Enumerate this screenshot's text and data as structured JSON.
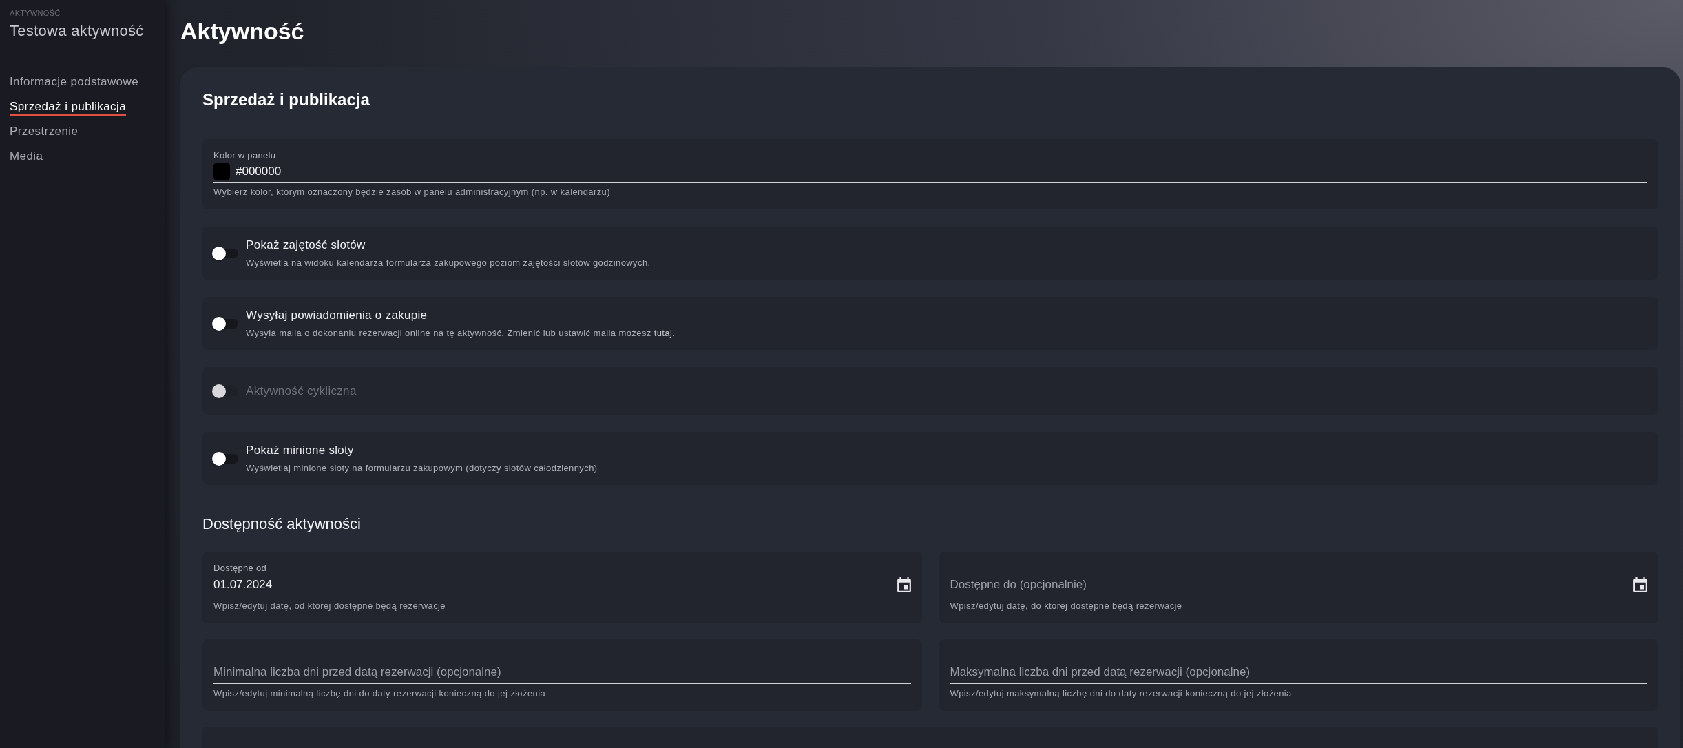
{
  "sidebar": {
    "eyebrow": "AKTYWNOŚĆ",
    "title": "Testowa aktywność",
    "items": [
      {
        "label": "Informacje podstawowe",
        "selected": false
      },
      {
        "label": "Sprzedaż i publikacja",
        "selected": true
      },
      {
        "label": "Przestrzenie",
        "selected": false
      },
      {
        "label": "Media",
        "selected": false
      }
    ]
  },
  "page": {
    "title": "Aktywność"
  },
  "card": {
    "title": "Sprzedaż i publikacja"
  },
  "color_field": {
    "label": "Kolor w panelu",
    "value": "#000000",
    "color": "#000000",
    "helper": "Wybierz kolor, którym oznaczony będzie zasób w panelu administracyjnym (np. w kalendarzu)"
  },
  "toggles": [
    {
      "title": "Pokaż zajętość slotów",
      "description": "Wyświetla na widoku kalendarza formularza zakupowego poziom zajętości slotów godzinowych.",
      "on": false,
      "disabled": false
    },
    {
      "title": "Wysyłaj powiadomienia o zakupie",
      "description": "Wysyła maila o dokonaniu rezerwacji online na tę aktywność. Zmienić lub ustawić maila możesz",
      "link": "tutaj.",
      "on": false,
      "disabled": false
    },
    {
      "title": "Aktywność cykliczna",
      "on": false,
      "disabled": true
    },
    {
      "title": "Pokaż minione sloty",
      "description": "Wyświetlaj minione sloty na formularzu zakupowym (dotyczy slotów całodziennych)",
      "on": false,
      "disabled": false
    }
  ],
  "availability": {
    "title": "Dostępność aktywności",
    "fields": [
      {
        "kind": "date",
        "label": "Dostępne od",
        "value": "01.07.2024",
        "helper": "Wpisz/edytuj datę, od której dostępne będą rezerwacje"
      },
      {
        "kind": "date",
        "placeholder": "Dostępne do (opcjonalnie)",
        "helper": "Wpisz/edytuj datę, do której dostępne będą rezerwacje"
      },
      {
        "kind": "number",
        "placeholder": "Minimalna liczba dni przed datą rezerwacji (opcjonalne)",
        "helper": "Wpisz/edytuj minimalną liczbę dni do daty rezerwacji konieczną do jej złożenia"
      },
      {
        "kind": "number",
        "placeholder": "Maksymalna liczba dni przed datą rezerwacji (opcjonalne)",
        "helper": "Wpisz/edytuj maksymalną liczbę dni do daty rezerwacji konieczną do jej złożenia"
      }
    ]
  }
}
